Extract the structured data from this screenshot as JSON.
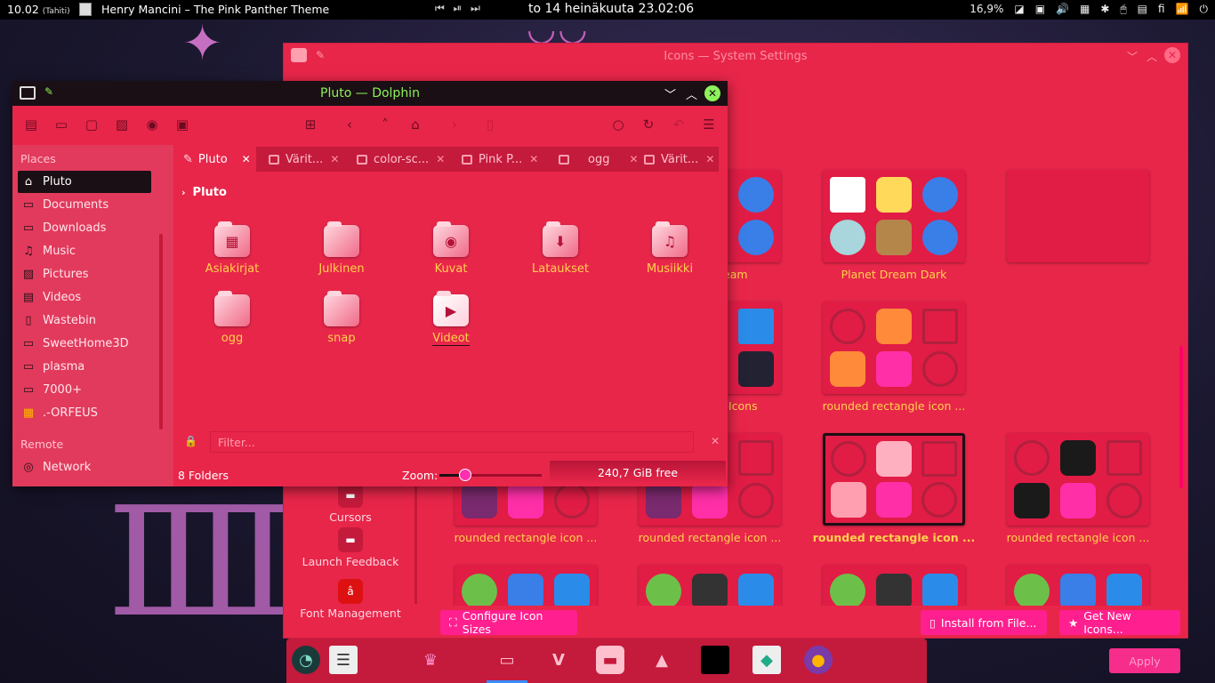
{
  "topbar": {
    "clock": "10.02",
    "timezone": "(Tahiti)",
    "now_playing": "Henry Mancini – The Pink Panther Theme",
    "media_controls": "⏮ ⏯ ⏭",
    "date": "to 14 heinäkuuta 23.02:06",
    "battery": "16,9%",
    "tray_icons": [
      "◪",
      "▣",
      "🔊",
      "▦",
      "✱",
      "🖱",
      "▤",
      "fi",
      "📶",
      "⏻"
    ]
  },
  "settings": {
    "title": "Icons — System Settings",
    "sidebar": [
      {
        "label": "Cursors"
      },
      {
        "label": "Launch Feedback"
      },
      {
        "label": "Font Management"
      }
    ],
    "themes": [
      {
        "label": "Planet Dream"
      },
      {
        "label": "Planet Dream Dark"
      },
      {
        "label": "Relax-Light-Icons"
      },
      {
        "label": "rounded rectangle icon ..."
      },
      {
        "label": "rounded rectangle icon ..."
      },
      {
        "label": "rounded rectangle icon ..."
      },
      {
        "label": "rounded rectangle icon ..."
      },
      {
        "label": "rounded rectangle icon ..."
      }
    ],
    "partial_labels": {
      "left1": "rk",
      "left2": "cons"
    },
    "buttons": {
      "configure": "Configure Icon Sizes",
      "install": "Install from File...",
      "get_new": "Get New Icons...",
      "apply": "Apply"
    }
  },
  "dolphin": {
    "title": "Pluto — Dolphin",
    "places_header": "Places",
    "remote_header": "Remote",
    "places": [
      {
        "label": "Pluto",
        "icon": "home-icon"
      },
      {
        "label": "Documents",
        "icon": "documents-icon"
      },
      {
        "label": "Downloads",
        "icon": "downloads-icon"
      },
      {
        "label": "Music",
        "icon": "music-icon"
      },
      {
        "label": "Pictures",
        "icon": "pictures-icon"
      },
      {
        "label": "Videos",
        "icon": "videos-icon"
      },
      {
        "label": "Wastebin",
        "icon": "trash-icon"
      },
      {
        "label": "SweetHome3D",
        "icon": "folder-icon"
      },
      {
        "label": "plasma",
        "icon": "folder-icon"
      },
      {
        "label": "7000+",
        "icon": "folder-icon"
      },
      {
        "label": ".-ORFEUS",
        "icon": "folder-icon"
      }
    ],
    "remote": [
      {
        "label": "Network",
        "icon": "network-icon"
      }
    ],
    "tabs": [
      "Pluto",
      "Värit...",
      "color-sc...",
      "Pink P...",
      "ogg",
      "Värit..."
    ],
    "breadcrumb": "Pluto",
    "folders": [
      {
        "label": "Asiakirjat",
        "glyph": "▦"
      },
      {
        "label": "Julkinen",
        "glyph": ""
      },
      {
        "label": "Kuvat",
        "glyph": "◉"
      },
      {
        "label": "Lataukset",
        "glyph": "⬇"
      },
      {
        "label": "Musiikki",
        "glyph": "♫"
      },
      {
        "label": "ogg",
        "glyph": ""
      },
      {
        "label": "snap",
        "glyph": ""
      },
      {
        "label": "Videot",
        "glyph": "▶"
      }
    ],
    "filter_placeholder": "Filter...",
    "status": "8 Folders",
    "zoom_label": "Zoom:",
    "zoom_fraction": 0.25,
    "free_space": "240,7 GiB free"
  },
  "dock": {
    "items": [
      "clock-icon",
      "notes-icon",
      "pink-panther-icon",
      "folder-icon",
      "vivaldi-icon",
      "settings-icon",
      "vlc-icon",
      "terminal-icon",
      "app-icon",
      "orange-app-icon"
    ]
  },
  "colors": {
    "accent": "#e8264a",
    "dark": "#1a0f14",
    "highlight_green": "#8cf35a",
    "label_yellow": "#ffd24a",
    "button_pink": "#ff1f8e"
  }
}
